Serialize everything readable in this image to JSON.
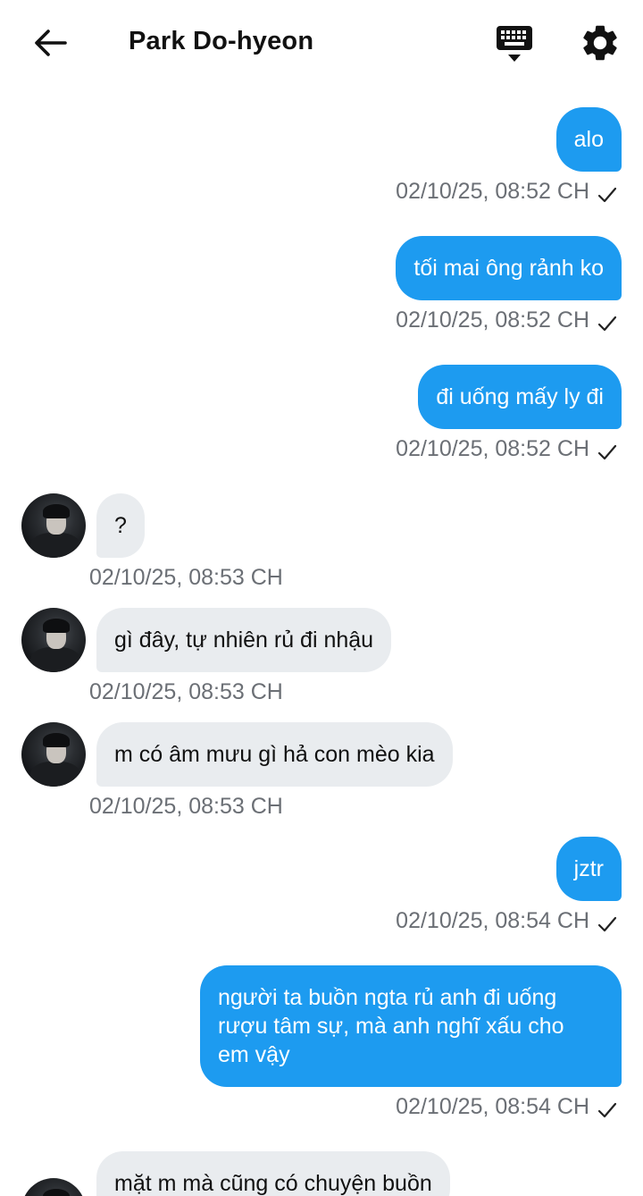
{
  "header": {
    "title": "Park Do-hyeon",
    "back_icon": "arrow-left-icon",
    "keyboard_icon": "keyboard-icon",
    "settings_icon": "gear-icon"
  },
  "colors": {
    "outgoing_bubble": "#1d9bf0",
    "incoming_bubble": "#e9ecef",
    "timestamp": "#6b6f75"
  },
  "messages": [
    {
      "direction": "out",
      "text": "alo",
      "time": "02/10/25, 08:52 CH",
      "status": "check-icon"
    },
    {
      "direction": "out",
      "text": "tối mai ông rảnh ko",
      "time": "02/10/25, 08:52 CH",
      "status": "check-icon"
    },
    {
      "direction": "out",
      "text": "đi uống mấy ly đi",
      "time": "02/10/25, 08:52 CH",
      "status": "check-icon"
    },
    {
      "direction": "in",
      "text": "?",
      "time": "02/10/25, 08:53 CH"
    },
    {
      "direction": "in",
      "text": "gì đây, tự nhiên rủ đi nhậu",
      "time": "02/10/25, 08:53 CH"
    },
    {
      "direction": "in",
      "text": "m có âm mưu gì hả con mèo kia",
      "time": "02/10/25, 08:53 CH"
    },
    {
      "direction": "out",
      "text": "jztr",
      "time": "02/10/25, 08:54 CH",
      "status": "check-icon"
    },
    {
      "direction": "out",
      "text": "người ta buồn ngta rủ anh đi uống\nrượu tâm sự, mà anh nghĩ xấu cho\nem vậy",
      "time": "02/10/25, 08:54 CH",
      "status": "check-icon"
    },
    {
      "direction": "in",
      "text": "mặt m mà cũng có chuyện buồn"
    }
  ]
}
